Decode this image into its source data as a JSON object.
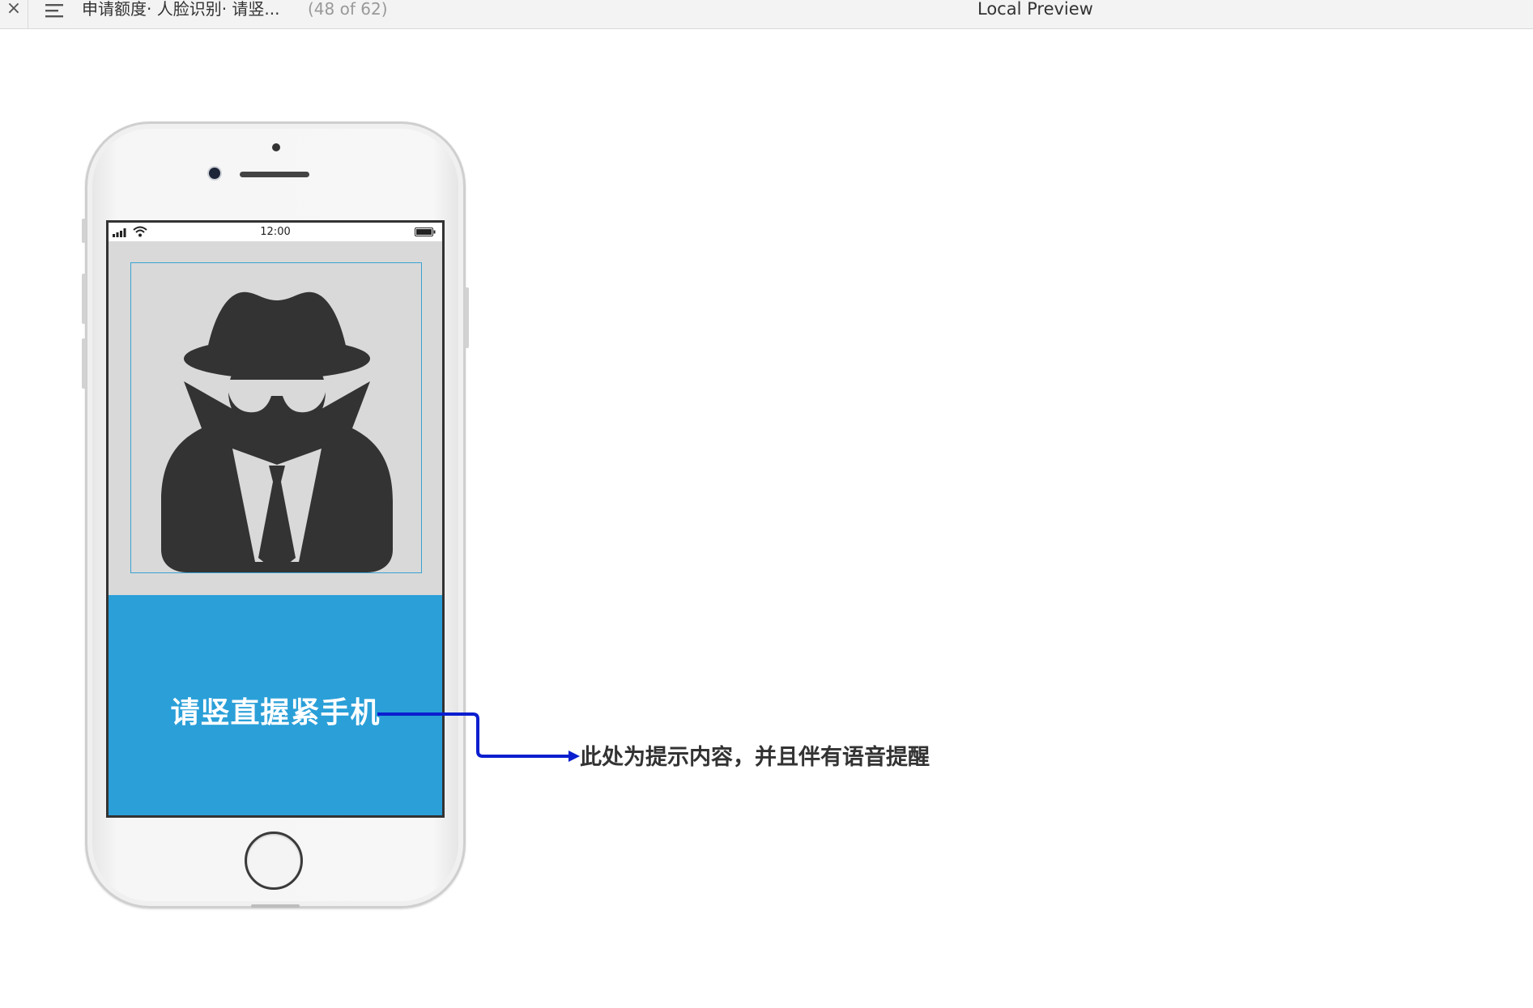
{
  "toolbar": {
    "close_glyph": "×",
    "document_title": "申请额度· 人脸识别· 请竖...",
    "page_counter": "(48 of 62)",
    "preview_title": "Local Preview"
  },
  "phone": {
    "status_time": "12:00",
    "prompt_text": "请竖直握紧手机",
    "icons": {
      "signal": "signal-icon",
      "wifi": "wifi-icon",
      "battery": "battery-icon",
      "avatar": "spy-avatar-icon"
    }
  },
  "annotation": {
    "text": "此处为提示内容，并且伴有语音提醒"
  },
  "colors": {
    "prompt_panel": "#2a9fd8",
    "face_area": "#d9d9d9",
    "face_frame": "#3aa2d3",
    "connector": "#0b1ecf",
    "avatar": "#333333"
  }
}
